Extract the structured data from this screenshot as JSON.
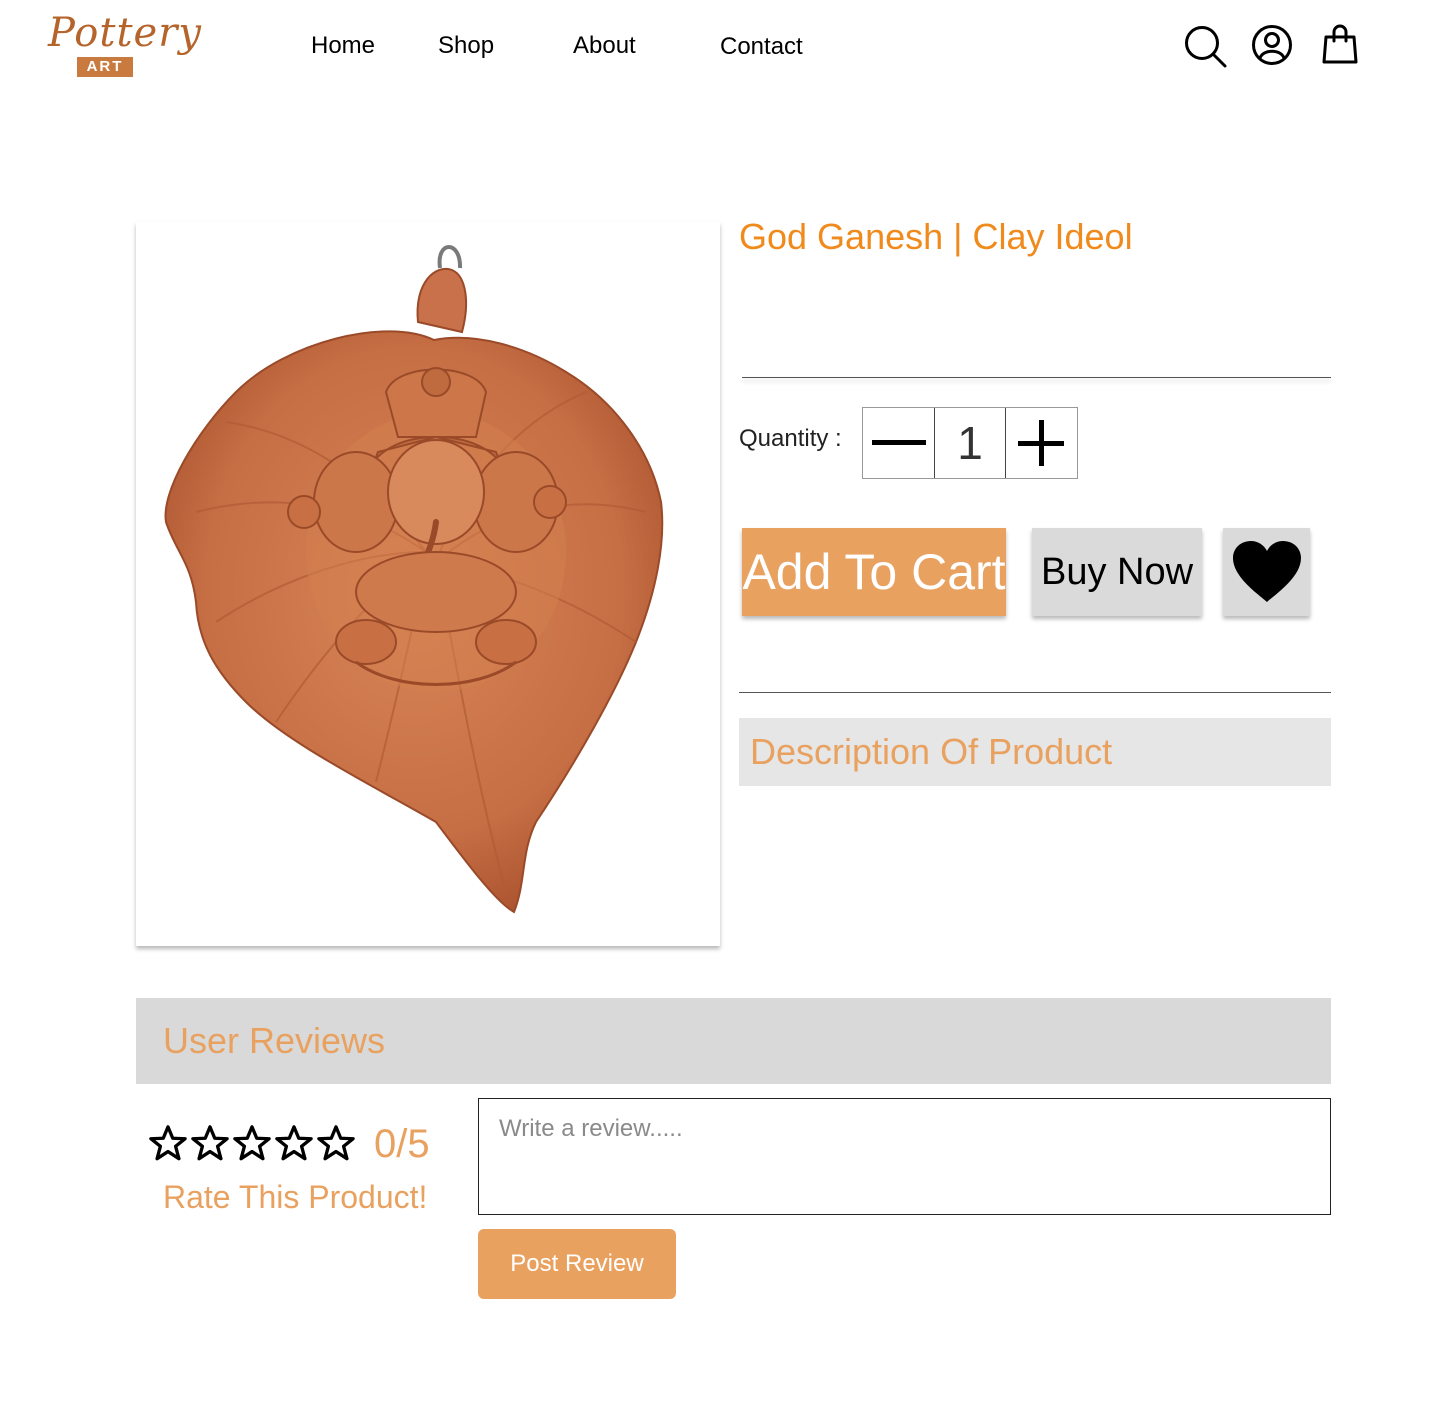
{
  "brand": {
    "script": "Pottery",
    "badge": "ART"
  },
  "nav": {
    "home": "Home",
    "shop": "Shop",
    "about": "About",
    "contact": "Contact"
  },
  "header_icons": [
    "search-icon",
    "user-icon",
    "shopping-bag-icon"
  ],
  "product": {
    "title": "God Ganesh | Clay Ideol",
    "quantity_label": "Quantity :",
    "quantity_value": "1",
    "add_to_cart": "Add To Cart",
    "buy_now": "Buy Now",
    "description_heading": "Description Of Product"
  },
  "reviews": {
    "heading": "User Reviews",
    "rating": "0/5",
    "rate_label": "Rate This Product!",
    "star_count": 5,
    "review_placeholder": "Write a review.....",
    "post_button": "Post Review"
  },
  "colors": {
    "accent": "#e9a160",
    "title": "#f08a1c",
    "button_grey": "#dadada",
    "terracotta": "#c8714a"
  }
}
